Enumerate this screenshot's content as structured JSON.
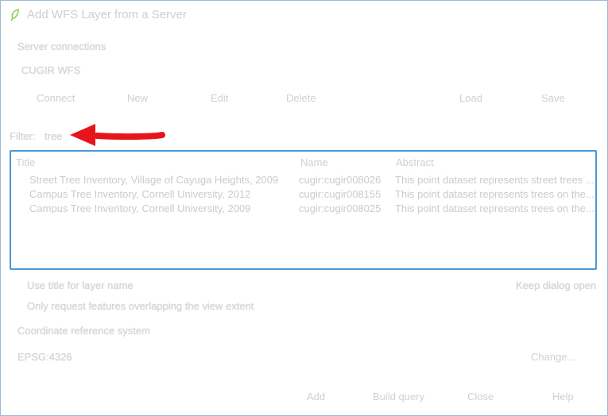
{
  "window": {
    "title": "Add WFS Layer from a Server"
  },
  "connections": {
    "label": "Server connections",
    "selected": "CUGIR WFS",
    "buttons": {
      "connect": "Connect",
      "new": "New",
      "edit": "Edit",
      "delete": "Delete",
      "load": "Load",
      "save": "Save"
    }
  },
  "filter": {
    "label": "Filter:",
    "value": "tree"
  },
  "table": {
    "headers": {
      "title": "Title",
      "name": "Name",
      "abstract": "Abstract"
    },
    "rows": [
      {
        "title": "Street Tree Inventory, Village of Cayuga Heights, 2009",
        "name": "cugir:cugir008026",
        "abstract": "This point dataset represents street trees ..."
      },
      {
        "title": "Campus Tree Inventory, Cornell University, 2012",
        "name": "cugir:cugir008155",
        "abstract": "This point dataset represents trees on the..."
      },
      {
        "title": "Campus Tree Inventory, Cornell University, 2009",
        "name": "cugir:cugir008025",
        "abstract": "This point dataset represents trees on the..."
      }
    ]
  },
  "options": {
    "use_title": "Use title for layer name",
    "keep_open": "Keep dialog open",
    "only_request": "Only request features overlapping the view extent"
  },
  "crs": {
    "label": "Coordinate reference system",
    "value": "EPSG:4326",
    "change": "Change..."
  },
  "footer": {
    "add": "Add",
    "build_query": "Build query",
    "close": "Close",
    "help": "Help"
  },
  "colors": {
    "accent_border": "#4a97d9",
    "arrow": "#e8141c",
    "leaf": "#7dc242"
  },
  "icons": {
    "window": "leaf-icon",
    "annotation": "red-arrow"
  }
}
